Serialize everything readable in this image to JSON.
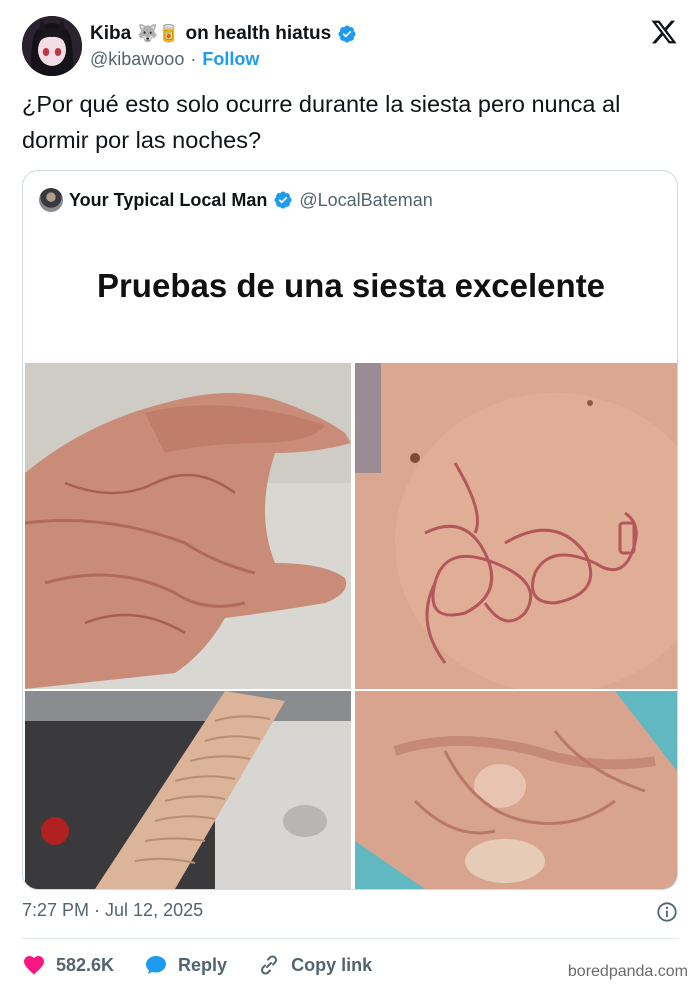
{
  "author": {
    "display_name": "Kiba",
    "emojis": "🐺🥫",
    "name_suffix": "on health hiatus",
    "handle": "@kibawooo",
    "separator": "·",
    "follow_label": "Follow",
    "verified": true,
    "avatar_icon": "anime-avatar"
  },
  "platform_icon": "x-logo",
  "tweet": {
    "text": "¿Por qué esto solo ocurre durante la siesta pero nunca al dormir por las noches?"
  },
  "quoted": {
    "display_name": "Your Typical Local Man",
    "handle": "@LocalBateman",
    "verified": true,
    "title": "Pruebas de una siesta excelente",
    "photos": [
      "hand-with-sleep-marks",
      "shoulder-with-cable-imprint",
      "arm-with-wrinkle-marks",
      "hand-with-pressure-marks"
    ]
  },
  "meta": {
    "timestamp": "7:27 PM · Jul 12, 2025"
  },
  "actions": {
    "like_count": "582.6K",
    "reply_label": "Reply",
    "copy_link_label": "Copy link"
  },
  "colors": {
    "accent": "#1d9bf0",
    "like": "#f91880",
    "reply": "#1d9bf0",
    "muted": "#536471"
  },
  "watermark": "boredpanda.com"
}
